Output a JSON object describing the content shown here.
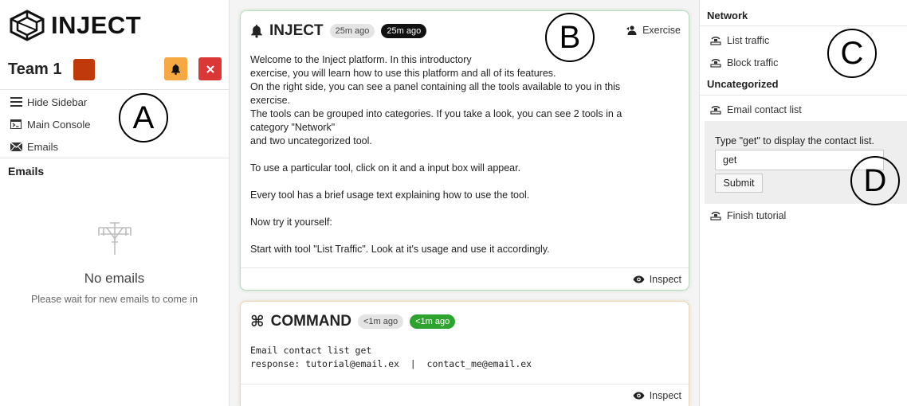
{
  "app": {
    "logo_text": "INJECT"
  },
  "sidebar": {
    "team_name": "Team 1",
    "team_color": "#c0390b",
    "nav": [
      {
        "label": "Hide Sidebar",
        "icon": "menu-icon"
      },
      {
        "label": "Main Console",
        "icon": "console-icon"
      },
      {
        "label": "Emails",
        "icon": "mail-icon"
      }
    ],
    "emails_heading": "Emails",
    "empty_title": "No emails",
    "empty_subtitle": "Please wait for new emails to come in"
  },
  "markers": {
    "a": "A",
    "b": "B",
    "c": "C",
    "d": "D"
  },
  "inject_card": {
    "title": "INJECT",
    "time_relative": "25m ago",
    "time_relative_2": "25m ago",
    "tag": "Exercise",
    "lines": [
      "Welcome to the Inject platform. In this introductory",
      "exercise, you will learn how to use this platform and all of its features.",
      "On the right side, you can see a panel containing all the tools available to you in this",
      "exercise.",
      "The tools can be grouped into categories. If you take a look, you can see 2 tools in a",
      "category \"Network\"",
      "and two uncategorized tool.",
      "",
      "To use a particular tool, click on it and a input box will appear.",
      "",
      "Every tool has a brief usage text explaining how to use the tool.",
      "",
      "Now try it yourself:",
      "",
      "Start with tool \"List Traffic\". Look at it's usage and use it accordingly."
    ],
    "inspect_label": "Inspect"
  },
  "command_card": {
    "title": "COMMAND",
    "time_relative": "<1m ago",
    "time_relative_2": "<1m ago",
    "command_line": "Email contact list get",
    "response_line": "response: tutorial@email.ex  |  contact_me@email.ex",
    "inspect_label": "Inspect"
  },
  "tools_panel": {
    "network_heading": "Network",
    "network_tools": [
      "List traffic",
      "Block traffic"
    ],
    "uncategorized_heading": "Uncategorized",
    "uncategorized_tools": [
      "Email contact list",
      "Finish tutorial"
    ],
    "usage_text": "Type \"get\" to display the contact list.",
    "input_value": "get",
    "submit_label": "Submit"
  },
  "colors": {
    "bell_button": "#f6a942",
    "close_button": "#db3737",
    "new_badge": "#2fa32f",
    "inject_border": "#b8dcc0",
    "command_border": "#ecd6b4"
  }
}
